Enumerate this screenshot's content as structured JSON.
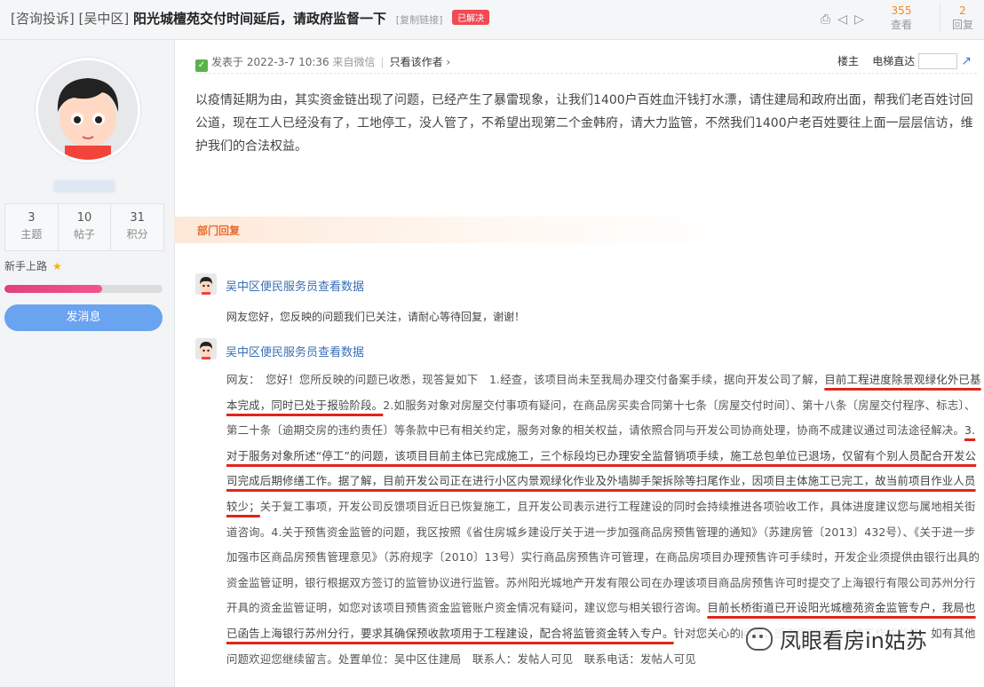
{
  "header": {
    "tag": "[咨询投诉]",
    "district": "[吴中区]",
    "title": "阳光城檀苑交付时间延后，请政府监督一下",
    "copy_link": "[复制链接]",
    "badge": "已解决",
    "icons": [
      "print-icon",
      "prev-icon",
      "next-icon"
    ],
    "views": {
      "value": "355",
      "label": "查看"
    },
    "replies": {
      "value": "2",
      "label": "回复"
    }
  },
  "sidebar": {
    "username": "网友",
    "stats": [
      {
        "value": "3",
        "label": "主题"
      },
      {
        "value": "10",
        "label": "帖子"
      },
      {
        "value": "31",
        "label": "积分"
      }
    ],
    "rank": "新手上路",
    "progress": 0.62,
    "pm_button": "发消息"
  },
  "post": {
    "posted_at": "发表于 2022-3-7 10:36",
    "source": "来自微信",
    "author_only": "只看该作者",
    "floor": "楼主",
    "jump": "电梯直达",
    "body": "以疫情延期为由，其实资金链出现了问题，已经产生了暴雷现象，让我们1400户百姓血汗钱打水漂，请住建局和政府出面，帮我们老百姓讨回公道，现在工人已经没有了，工地停工，没人管了，不希望出现第二个金韩府，请大力监管，不然我们1400户老百姓要往上面一层层信访，维护我们的合法权益。"
  },
  "dept": {
    "label": "部门回复"
  },
  "replies": [
    {
      "author": "吴中区便民服务员查看数据",
      "text": "网友您好，您反映的问题我们已关注，请耐心等待回复，谢谢！"
    },
    {
      "author": "吴中区便民服务员查看数据",
      "segments": [
        "网友：　您好！您所反映的问题已收悉，现答复如下　1.经查，该项目尚未至我局办理交付备案手续，据向开发公司了解，",
        "目前工程进度除景观绿化外已基本完成，同时已处于报验阶段。",
        "2.如服务对象对房屋交付事项有疑问，在商品房买卖合同第十七条〔房屋交付时间〕、第十八条〔房屋交付程序、标志〕、第二十条〔逾期交房的违约责任〕等条款中已有相关约定，服务对象的相关权益，请依照合同与开发公司协商处理，协商不成建议通过司法途径解决。",
        "3.对于服务对象所述“停工”的问题，该项目目前主体已完成施工，三个标段均已办理安全监督销项手续，施工总包单位已退场，仅留有个别人员配合开发公司完成后期修缮工作。",
        "据了解，目前开发公司正在进行小区内景观绿化作业及外墙脚手架拆除等扫尾作业，因项目主体施工已完工，故当前项目作业人员较少；",
        "关于复工事项，开发公司反馈项目近日已恢复施工，且开发公司表示进行工程建设的同时会持续推进各项验收工作，具体进度建议您与属地相关街道咨询。",
        "4.关于预售资金监管的问题，我区按照《省住房城乡建设厅关于进一步加强商品房预售管理的通知》（苏建房管〔2013〕432号）、《关于进一步加强市区商品房预售管理意见》（苏府规字〔2010〕13号）实行商品房预售许可管理，在商品房项目办理预售许可手续时，开发企业须提供由银行出具的资金监管证明，银行根据双方签订的监管协议进行监管。苏州阳光城地产开发有限公司在办理该项目商品房预售许可时提交了上海银行有限公司苏州分行开具的资金监管证明，如您对该项目预售资金监管账户资金情况有疑问，建议您与相关银行咨询。",
        "目前长桥街道已开设阳光城檀苑资金监管专户，我局也已函告上海银行苏州分行，要求其确保预收款项用于工程建设，配合将监管资金转入专户。",
        "针对您关心的问题，感谢您对我区住建工作的监督，如有其他问题欢迎您继续留言。",
        "处置单位：吴中区住建局　联系人：发帖人可见　联系电话：发帖人可见"
      ]
    }
  ],
  "watermark": "凤眼看房in姑苏"
}
